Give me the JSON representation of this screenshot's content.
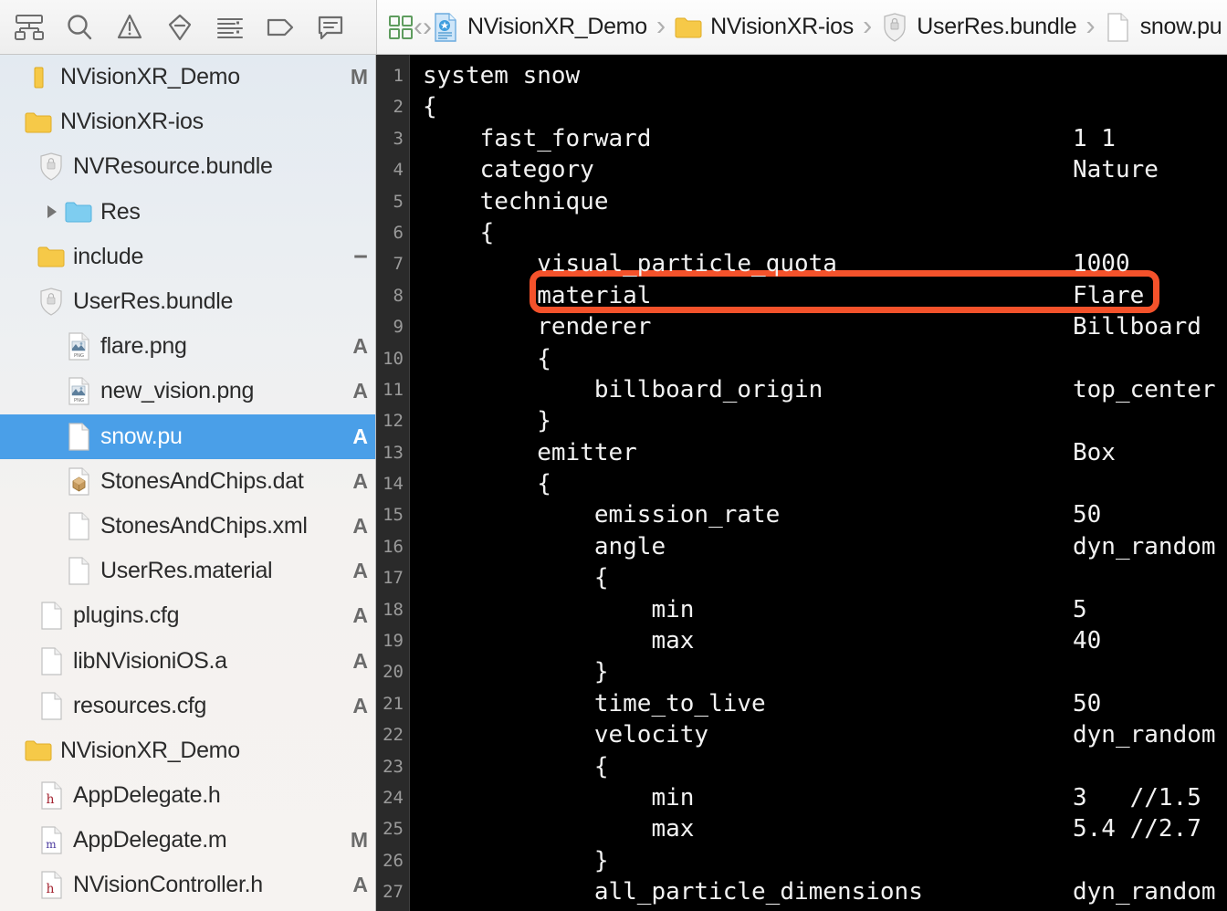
{
  "toolbar": {
    "buttons": [
      {
        "name": "project-navigator-icon",
        "title": "Show the Project navigator"
      },
      {
        "name": "find-navigator-icon",
        "title": "Show the Find navigator"
      },
      {
        "name": "issue-navigator-icon",
        "title": "Show the Issue navigator"
      },
      {
        "name": "test-navigator-icon",
        "title": "Show the Test navigator"
      },
      {
        "name": "debug-navigator-icon",
        "title": "Show the Debug navigator"
      },
      {
        "name": "breakpoint-navigator-icon",
        "title": "Show the Breakpoint navigator"
      },
      {
        "name": "report-navigator-icon",
        "title": "Show the Report navigator"
      }
    ]
  },
  "jump_bar": {
    "related-items-label": "",
    "back_label": "‹",
    "forward_label": "›",
    "separator": "›",
    "breadcrumbs": [
      {
        "label": "NVisionXR_Demo",
        "icon": "xcode-project-icon"
      },
      {
        "label": "NVisionXR-ios",
        "icon": "folder-icon"
      },
      {
        "label": "UserRes.bundle",
        "icon": "bundle-icon"
      },
      {
        "label": "snow.pu",
        "icon": "file-icon"
      }
    ]
  },
  "sidebar": {
    "rows": [
      {
        "label": "NVisionXR_Demo",
        "icon": "project-icon",
        "badge": "M",
        "indent": 0,
        "twisty": "",
        "selected": false
      },
      {
        "label": "NVisionXR-ios",
        "icon": "folder-yellow-icon",
        "badge": "",
        "indent": 0,
        "twisty": "",
        "selected": false
      },
      {
        "label": "NVResource.bundle",
        "icon": "bundle-icon",
        "badge": "",
        "indent": 1,
        "twisty": "",
        "selected": false
      },
      {
        "label": "Res",
        "icon": "folder-blue-icon",
        "badge": "",
        "indent": 2,
        "twisty": "closed",
        "selected": false
      },
      {
        "label": "include",
        "icon": "folder-yellow-icon",
        "badge": "−",
        "indent": 1,
        "twisty": "",
        "selected": false
      },
      {
        "label": "UserRes.bundle",
        "icon": "bundle-icon",
        "badge": "",
        "indent": 1,
        "twisty": "",
        "selected": false
      },
      {
        "label": "flare.png",
        "icon": "png-icon",
        "badge": "A",
        "indent": 2,
        "twisty": "",
        "selected": false
      },
      {
        "label": "new_vision.png",
        "icon": "png-icon",
        "badge": "A",
        "indent": 2,
        "twisty": "",
        "selected": false
      },
      {
        "label": "snow.pu",
        "icon": "file-icon",
        "badge": "A",
        "indent": 2,
        "twisty": "",
        "selected": true
      },
      {
        "label": "StonesAndChips.dat",
        "icon": "dat-icon",
        "badge": "A",
        "indent": 2,
        "twisty": "",
        "selected": false
      },
      {
        "label": "StonesAndChips.xml",
        "icon": "file-icon",
        "badge": "A",
        "indent": 2,
        "twisty": "",
        "selected": false
      },
      {
        "label": "UserRes.material",
        "icon": "file-icon",
        "badge": "A",
        "indent": 2,
        "twisty": "",
        "selected": false
      },
      {
        "label": "plugins.cfg",
        "icon": "file-icon",
        "badge": "A",
        "indent": 1,
        "twisty": "",
        "selected": false
      },
      {
        "label": "libNVisioniOS.a",
        "icon": "file-icon",
        "badge": "A",
        "indent": 1,
        "twisty": "",
        "selected": false
      },
      {
        "label": "resources.cfg",
        "icon": "file-icon",
        "badge": "A",
        "indent": 1,
        "twisty": "",
        "selected": false
      },
      {
        "label": "NVisionXR_Demo",
        "icon": "folder-yellow-icon",
        "badge": "",
        "indent": 0,
        "twisty": "",
        "selected": false
      },
      {
        "label": "AppDelegate.h",
        "icon": "header-icon",
        "badge": "",
        "indent": 1,
        "twisty": "",
        "selected": false
      },
      {
        "label": "AppDelegate.m",
        "icon": "objc-icon",
        "badge": "M",
        "indent": 1,
        "twisty": "",
        "selected": false
      },
      {
        "label": "NVisionController.h",
        "icon": "header-icon",
        "badge": "A",
        "indent": 1,
        "twisty": "",
        "selected": false
      }
    ]
  },
  "editor": {
    "filename": "snow.pu",
    "highlight_color": "#f4522b",
    "lines": [
      {
        "n": "1",
        "key": "system snow",
        "val": ""
      },
      {
        "n": "2",
        "key": "{",
        "val": ""
      },
      {
        "n": "3",
        "key": "    fast_forward",
        "val": "1 1"
      },
      {
        "n": "4",
        "key": "    category",
        "val": "Nature"
      },
      {
        "n": "5",
        "key": "    technique",
        "val": ""
      },
      {
        "n": "6",
        "key": "    {",
        "val": ""
      },
      {
        "n": "7",
        "key": "        visual_particle_quota",
        "val": "1000"
      },
      {
        "n": "8",
        "key": "        material",
        "val": "Flare"
      },
      {
        "n": "9",
        "key": "        renderer",
        "val": "Billboard"
      },
      {
        "n": "10",
        "key": "        {",
        "val": ""
      },
      {
        "n": "11",
        "key": "            billboard_origin",
        "val": "top_center"
      },
      {
        "n": "12",
        "key": "        }",
        "val": ""
      },
      {
        "n": "13",
        "key": "        emitter",
        "val": "Box"
      },
      {
        "n": "14",
        "key": "        {",
        "val": ""
      },
      {
        "n": "15",
        "key": "            emission_rate",
        "val": "50"
      },
      {
        "n": "16",
        "key": "            angle",
        "val": "dyn_random"
      },
      {
        "n": "17",
        "key": "            {",
        "val": ""
      },
      {
        "n": "18",
        "key": "                min",
        "val": "5"
      },
      {
        "n": "19",
        "key": "                max",
        "val": "40"
      },
      {
        "n": "20",
        "key": "            }",
        "val": ""
      },
      {
        "n": "21",
        "key": "            time_to_live",
        "val": "50"
      },
      {
        "n": "22",
        "key": "            velocity",
        "val": "dyn_random"
      },
      {
        "n": "23",
        "key": "            {",
        "val": ""
      },
      {
        "n": "24",
        "key": "                min",
        "val": "3   //1.5"
      },
      {
        "n": "25",
        "key": "                max",
        "val": "5.4 //2.7"
      },
      {
        "n": "26",
        "key": "            }",
        "val": ""
      },
      {
        "n": "27",
        "key": "            all_particle_dimensions",
        "val": "dyn_random"
      }
    ]
  }
}
